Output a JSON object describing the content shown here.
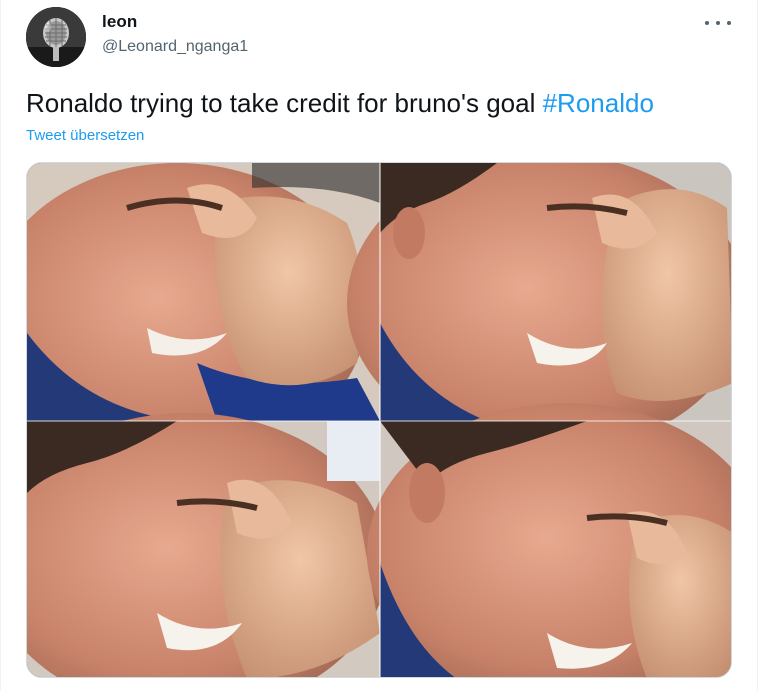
{
  "author": {
    "name": "leon",
    "handle": "@Leonard_nganga1",
    "avatar_icon": "microphone-avatar"
  },
  "tweet": {
    "text": "Ronaldo trying to take credit for bruno's goal ",
    "hashtag": "#Ronaldo",
    "translate_label": "Tweet übersetzen"
  },
  "menu": {
    "more_icon": "more-horizontal-icon"
  },
  "colors": {
    "accent": "#1d9bf0",
    "text": "#0f1419",
    "secondary": "#536471"
  }
}
